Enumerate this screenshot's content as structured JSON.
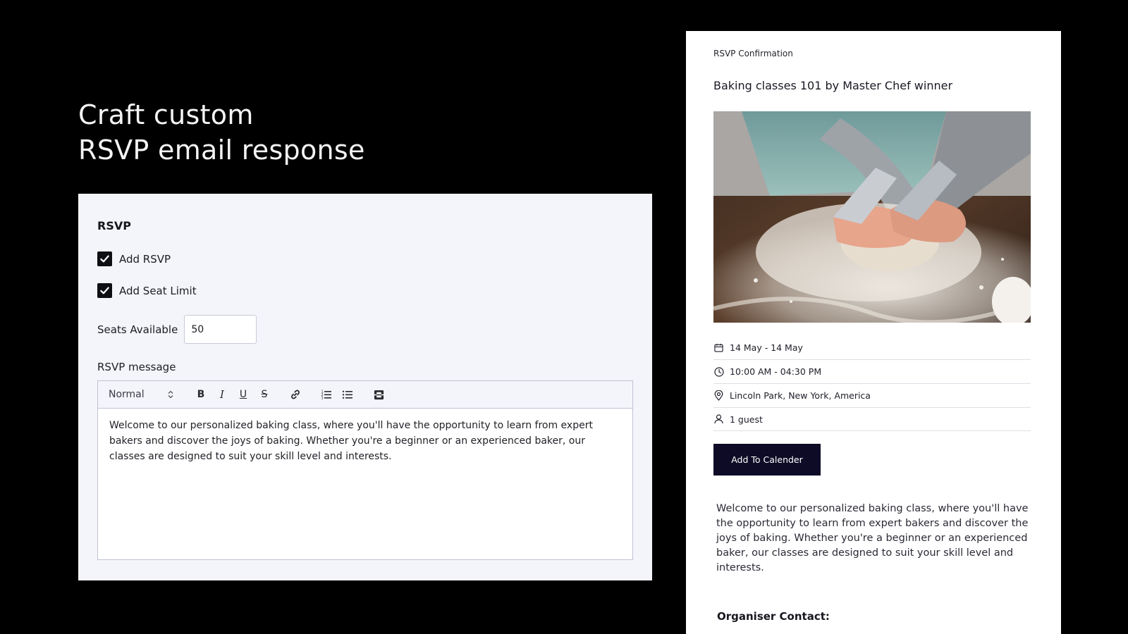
{
  "headline": {
    "line1": "Craft custom",
    "line2": "RSVP email response"
  },
  "editor": {
    "section_title": "RSVP",
    "add_rsvp": {
      "label": "Add RSVP",
      "checked": true
    },
    "add_seat_limit": {
      "label": "Add Seat Limit",
      "checked": true
    },
    "seats_available": {
      "label": "Seats Available",
      "value": "50"
    },
    "message_label": "RSVP message",
    "toolbar": {
      "format": "Normal",
      "icons": [
        "bold-icon",
        "italic-icon",
        "underline-icon",
        "strikethrough-icon",
        "link-icon",
        "ordered-list-icon",
        "bullet-list-icon",
        "video-icon"
      ]
    },
    "message": "Welcome to our personalized baking class, where you'll have the opportunity to learn from expert bakers and discover the joys of baking. Whether you're a beginner or an experienced baker, our classes are designed to suit your skill level and interests."
  },
  "preview": {
    "header": "RSVP Confirmation",
    "event_title": "Baking classes 101 by Master Chef winner",
    "date": "14 May - 14 May",
    "time": "10:00 AM - 04:30 PM",
    "location": "Lincoln Park, New York, America",
    "guests": "1 guest",
    "calendar_button": "Add To Calender",
    "message": "Welcome to our personalized baking class, where you'll have the opportunity to learn from expert bakers and discover the joys of baking. Whether you're a beginner or an experienced baker, our classes are designed to suit your skill level and interests.",
    "contact_label": "Organiser Contact:"
  },
  "colors": {
    "background": "#000000",
    "panel": "#f4f5fa",
    "button": "#0e0b26",
    "checkbox": "#0e0f13"
  }
}
